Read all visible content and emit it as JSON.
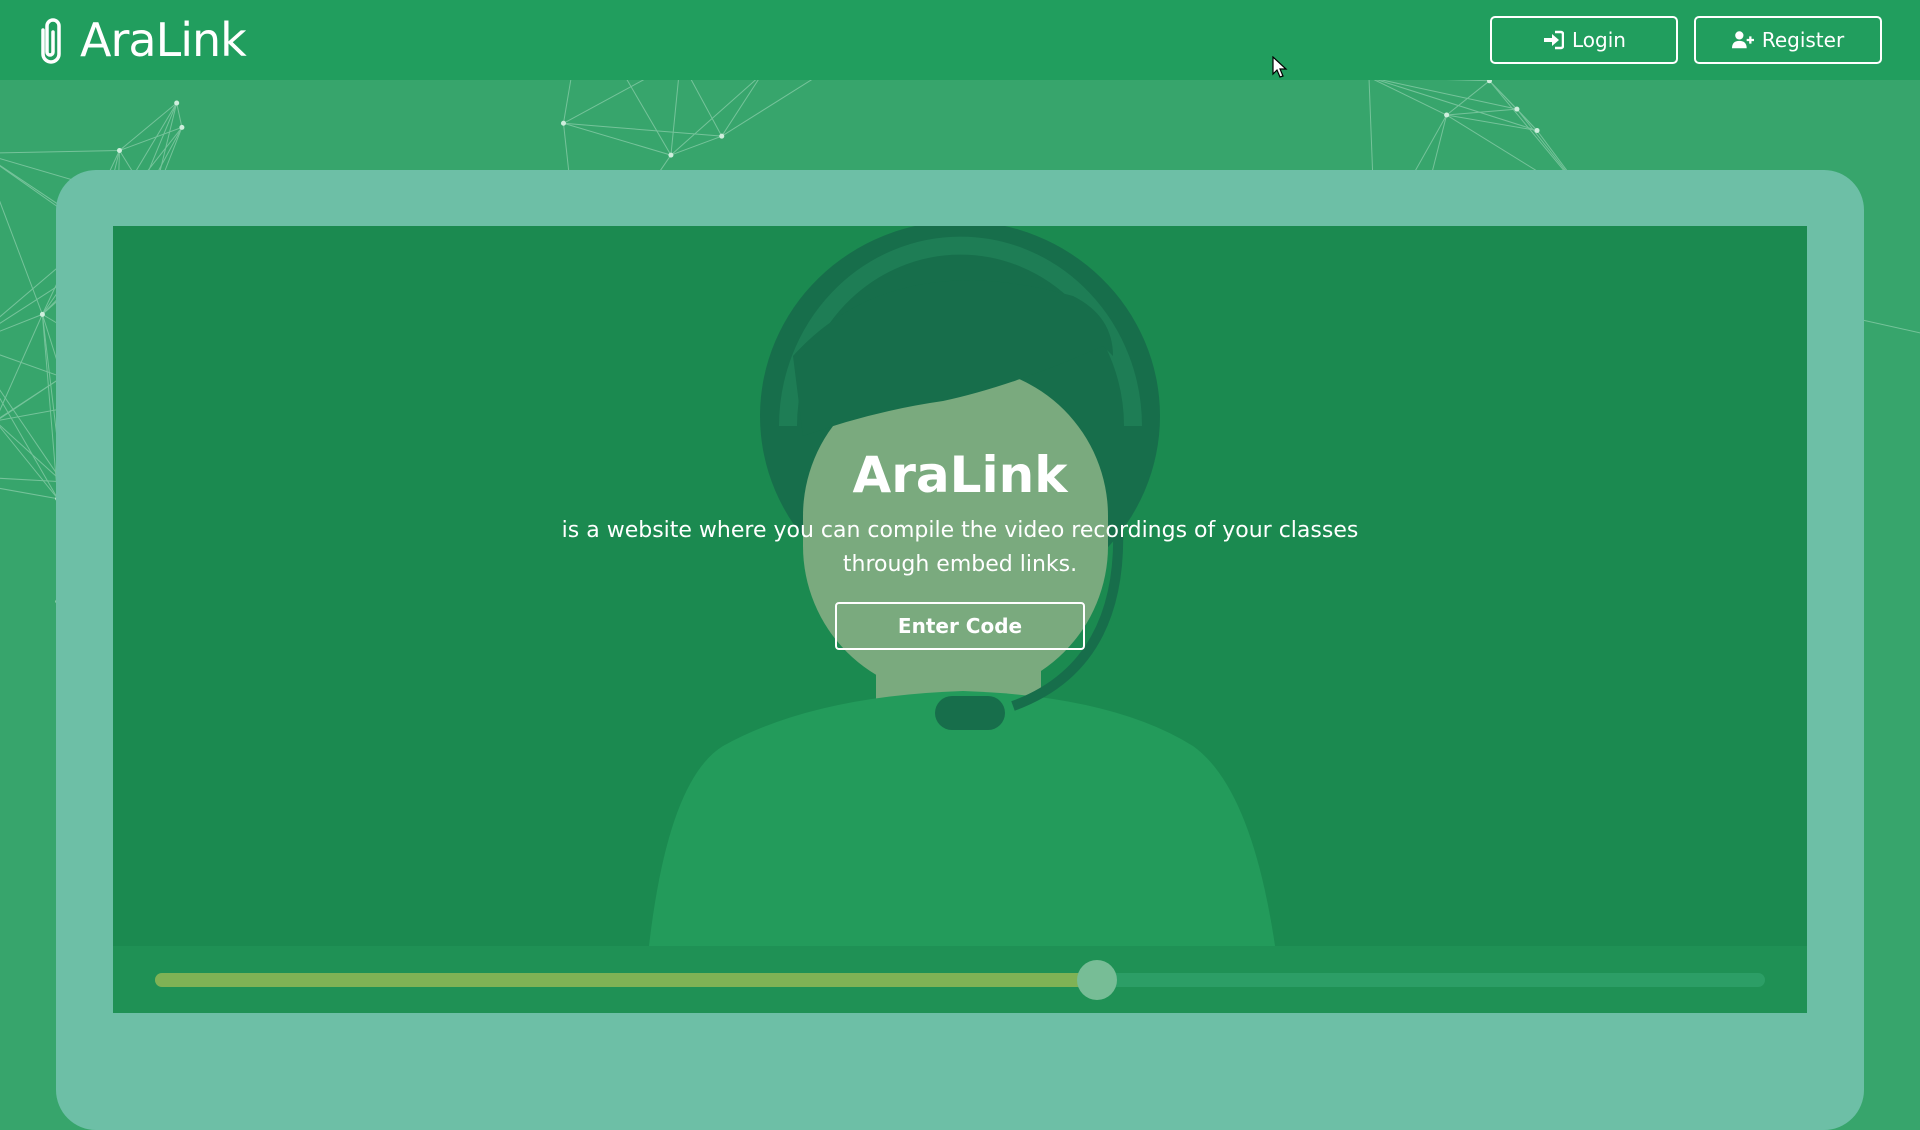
{
  "navbar": {
    "brand": "AraLink",
    "login_label": "Login",
    "register_label": "Register"
  },
  "hero": {
    "title": "AraLink",
    "description": "is a website where you can compile the video recordings of your classes through embed links.",
    "enter_code_label": "Enter Code"
  },
  "video": {
    "progress_fraction": 0.585
  },
  "colors": {
    "navbar": "#219e5e",
    "background": "#37a56c",
    "screen": "#1b8a50",
    "frame": "#6dbfa6",
    "progress_fill": "#7fb255"
  }
}
